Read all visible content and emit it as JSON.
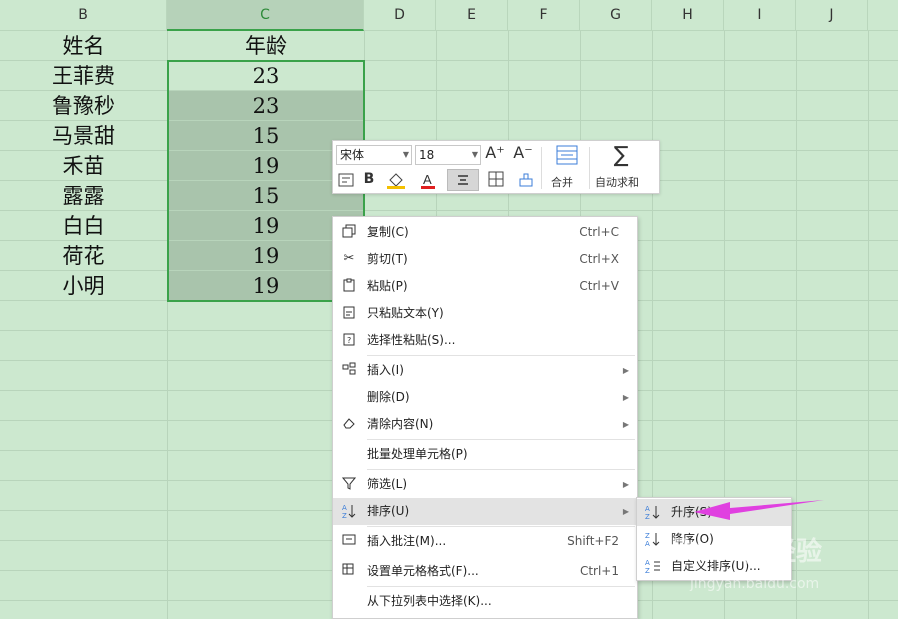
{
  "columns": [
    "B",
    "C",
    "D",
    "E",
    "F",
    "G",
    "H",
    "I",
    "J"
  ],
  "selected_column": "C",
  "headers": {
    "b": "姓名",
    "c": "年龄"
  },
  "rows": [
    {
      "name": "王菲费",
      "age": "23"
    },
    {
      "name": "鲁豫秒",
      "age": "23"
    },
    {
      "name": "马景甜",
      "age": "15"
    },
    {
      "name": "禾苗",
      "age": "19"
    },
    {
      "name": "露露",
      "age": "15"
    },
    {
      "name": "白白",
      "age": "19"
    },
    {
      "name": "荷花",
      "age": "19"
    },
    {
      "name": "小明",
      "age": "19"
    }
  ],
  "toolbar": {
    "font": "宋体",
    "size": "18",
    "grow_font": "A⁺",
    "shrink_font": "A⁻",
    "bold": "B",
    "merge_label": "合并",
    "autosum_label": "自动求和"
  },
  "menu": {
    "copy": {
      "label": "复制(C)",
      "shortcut": "Ctrl+C",
      "icon": "copy-icon"
    },
    "cut": {
      "label": "剪切(T)",
      "shortcut": "Ctrl+X",
      "icon": "scissors-icon"
    },
    "paste": {
      "label": "粘贴(P)",
      "shortcut": "Ctrl+V",
      "icon": "paste-icon"
    },
    "paste_text": {
      "label": "只粘贴文本(Y)",
      "icon": "paste-text-icon"
    },
    "paste_special": {
      "label": "选择性粘贴(S)...",
      "icon": "paste-special-icon"
    },
    "insert": {
      "label": "插入(I)",
      "icon": "insert-icon"
    },
    "delete": {
      "label": "删除(D)"
    },
    "clear": {
      "label": "清除内容(N)",
      "icon": "eraser-icon"
    },
    "batch": {
      "label": "批量处理单元格(P)"
    },
    "filter": {
      "label": "筛选(L)",
      "icon": "filter-icon"
    },
    "sort": {
      "label": "排序(U)",
      "icon": "sort-icon"
    },
    "comment": {
      "label": "插入批注(M)...",
      "shortcut": "Shift+F2",
      "icon": "comment-icon"
    },
    "format": {
      "label": "设置单元格格式(F)...",
      "shortcut": "Ctrl+1",
      "icon": "format-cells-icon"
    },
    "dropdown": {
      "label": "从下拉列表中选择(K)..."
    }
  },
  "submenu": {
    "asc": "升序(S)",
    "desc": "降序(O)",
    "custom": "自定义排序(U)..."
  },
  "colors": {
    "sheet_bg": "#cce8cf",
    "selection_border": "#3aa24a",
    "arrow": "#e040e0"
  }
}
